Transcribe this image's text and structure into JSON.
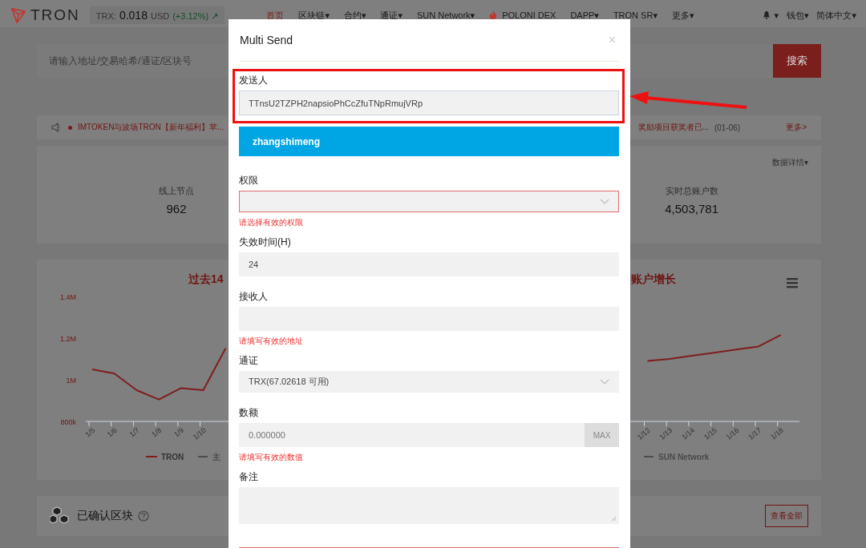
{
  "header": {
    "logo": "TRON",
    "price_label": "TRX:",
    "price": "0.018",
    "currency": "USD",
    "change": "(+3.12%)",
    "change_icon": "↗",
    "nav": [
      {
        "label": "首页",
        "selected": true
      },
      {
        "label": "区块链",
        "selected": false,
        "caret": "▾"
      },
      {
        "label": "合约",
        "selected": false,
        "caret": "▾"
      },
      {
        "label": "通证",
        "selected": false,
        "caret": "▾"
      },
      {
        "label": "SUN Network",
        "selected": false,
        "caret": "▾"
      },
      {
        "label": "POLONI DEX",
        "selected": false,
        "kind": "fire"
      },
      {
        "label": "DAPP",
        "selected": false,
        "caret": "▾"
      },
      {
        "label": "TRON SR",
        "selected": false,
        "caret": "▾"
      },
      {
        "label": "更多",
        "selected": false,
        "caret": "▾"
      }
    ],
    "right": [
      {
        "kind": "bell",
        "caret": "▾"
      },
      {
        "label": "钱包",
        "kind": "menu",
        "caret": "▾"
      },
      {
        "label": "简体中文",
        "kind": "menu",
        "caret": "▾"
      }
    ]
  },
  "search": {
    "placeholder": "请输入地址/交易哈希/通证/区块号",
    "button": "搜索"
  },
  "announcement": {
    "left": "IMTOKEN与波场TRON【新年福利】苹...",
    "right": "奖励项目获奖者已...",
    "date": "(01-06)",
    "more": "更多>"
  },
  "stats": {
    "details": "数据详情",
    "details_caret": "▾",
    "items": [
      {
        "label": "线上节点",
        "value": "962"
      },
      {
        "label": "实时总账户数",
        "value": "4,503,781"
      }
    ]
  },
  "chart": {
    "title_left": "过去14",
    "title_right": "账户增长",
    "other_legend": [
      {
        "name": "主",
        "color": "#4d4d4d"
      },
      {
        "name": "SUN Network",
        "color": "#4d4d4d"
      }
    ],
    "chart_data": {
      "type": "line",
      "categories": [
        "1/5",
        "1/6",
        "1/7",
        "1/8",
        "1/9",
        "1/10",
        null,
        null,
        null,
        null,
        null,
        null,
        null,
        null,
        null,
        null,
        null,
        null,
        null,
        null,
        null,
        null,
        null,
        null,
        null,
        "1/12",
        "1/13",
        "1/14",
        "1/15",
        "1/16",
        "1/17",
        "1/18"
      ],
      "series": [
        {
          "name": "TRON",
          "color": "#7f1d1d",
          "values": [
            1050000,
            1030000,
            950000,
            905000,
            960000,
            950000,
            1150000,
            null,
            null,
            null,
            null,
            null,
            null,
            null,
            null,
            null,
            null,
            null,
            null,
            null,
            null,
            null,
            null,
            null,
            null,
            1090000,
            1100000,
            1115000,
            1130000,
            1145000,
            1160000,
            1215000
          ]
        }
      ],
      "ylim": [
        800000,
        1400000
      ],
      "yticks": [
        {
          "value": 800000,
          "label": "800k"
        },
        {
          "value": 1000000,
          "label": "1M"
        },
        {
          "value": 1200000,
          "label": "1.2M"
        },
        {
          "value": 1400000,
          "label": "1.4M"
        }
      ]
    }
  },
  "blocks": {
    "title": "已确认区块",
    "view_all": "查看全部"
  },
  "modal": {
    "title": "Multi Send",
    "close": "×",
    "sender": {
      "label": "发送人",
      "value": "TTnsU2TZPH2napsioPhCcZfuTNpRmujVRp"
    },
    "account": "zhangshimeng",
    "fields": [
      {
        "label": "权限",
        "kind": "select",
        "invalid": true,
        "error": "请选择有效的权限"
      },
      {
        "label": "失效时间(H)",
        "kind": "input",
        "value": "24",
        "invalid": false
      },
      {
        "label": "接收人",
        "kind": "input",
        "invalid": false,
        "error": "请填写有效的地址"
      },
      {
        "label": "通证",
        "kind": "select",
        "value": "TRX(67.02618 可用)",
        "invalid": false
      },
      {
        "label": "数额",
        "kind": "amount",
        "placeholder": "0.000000",
        "button": "MAX",
        "invalid": false,
        "error": "请填写有效的数值"
      },
      {
        "label": "备注",
        "kind": "textarea",
        "invalid": false
      }
    ]
  },
  "annotation": {
    "highlight": true
  }
}
